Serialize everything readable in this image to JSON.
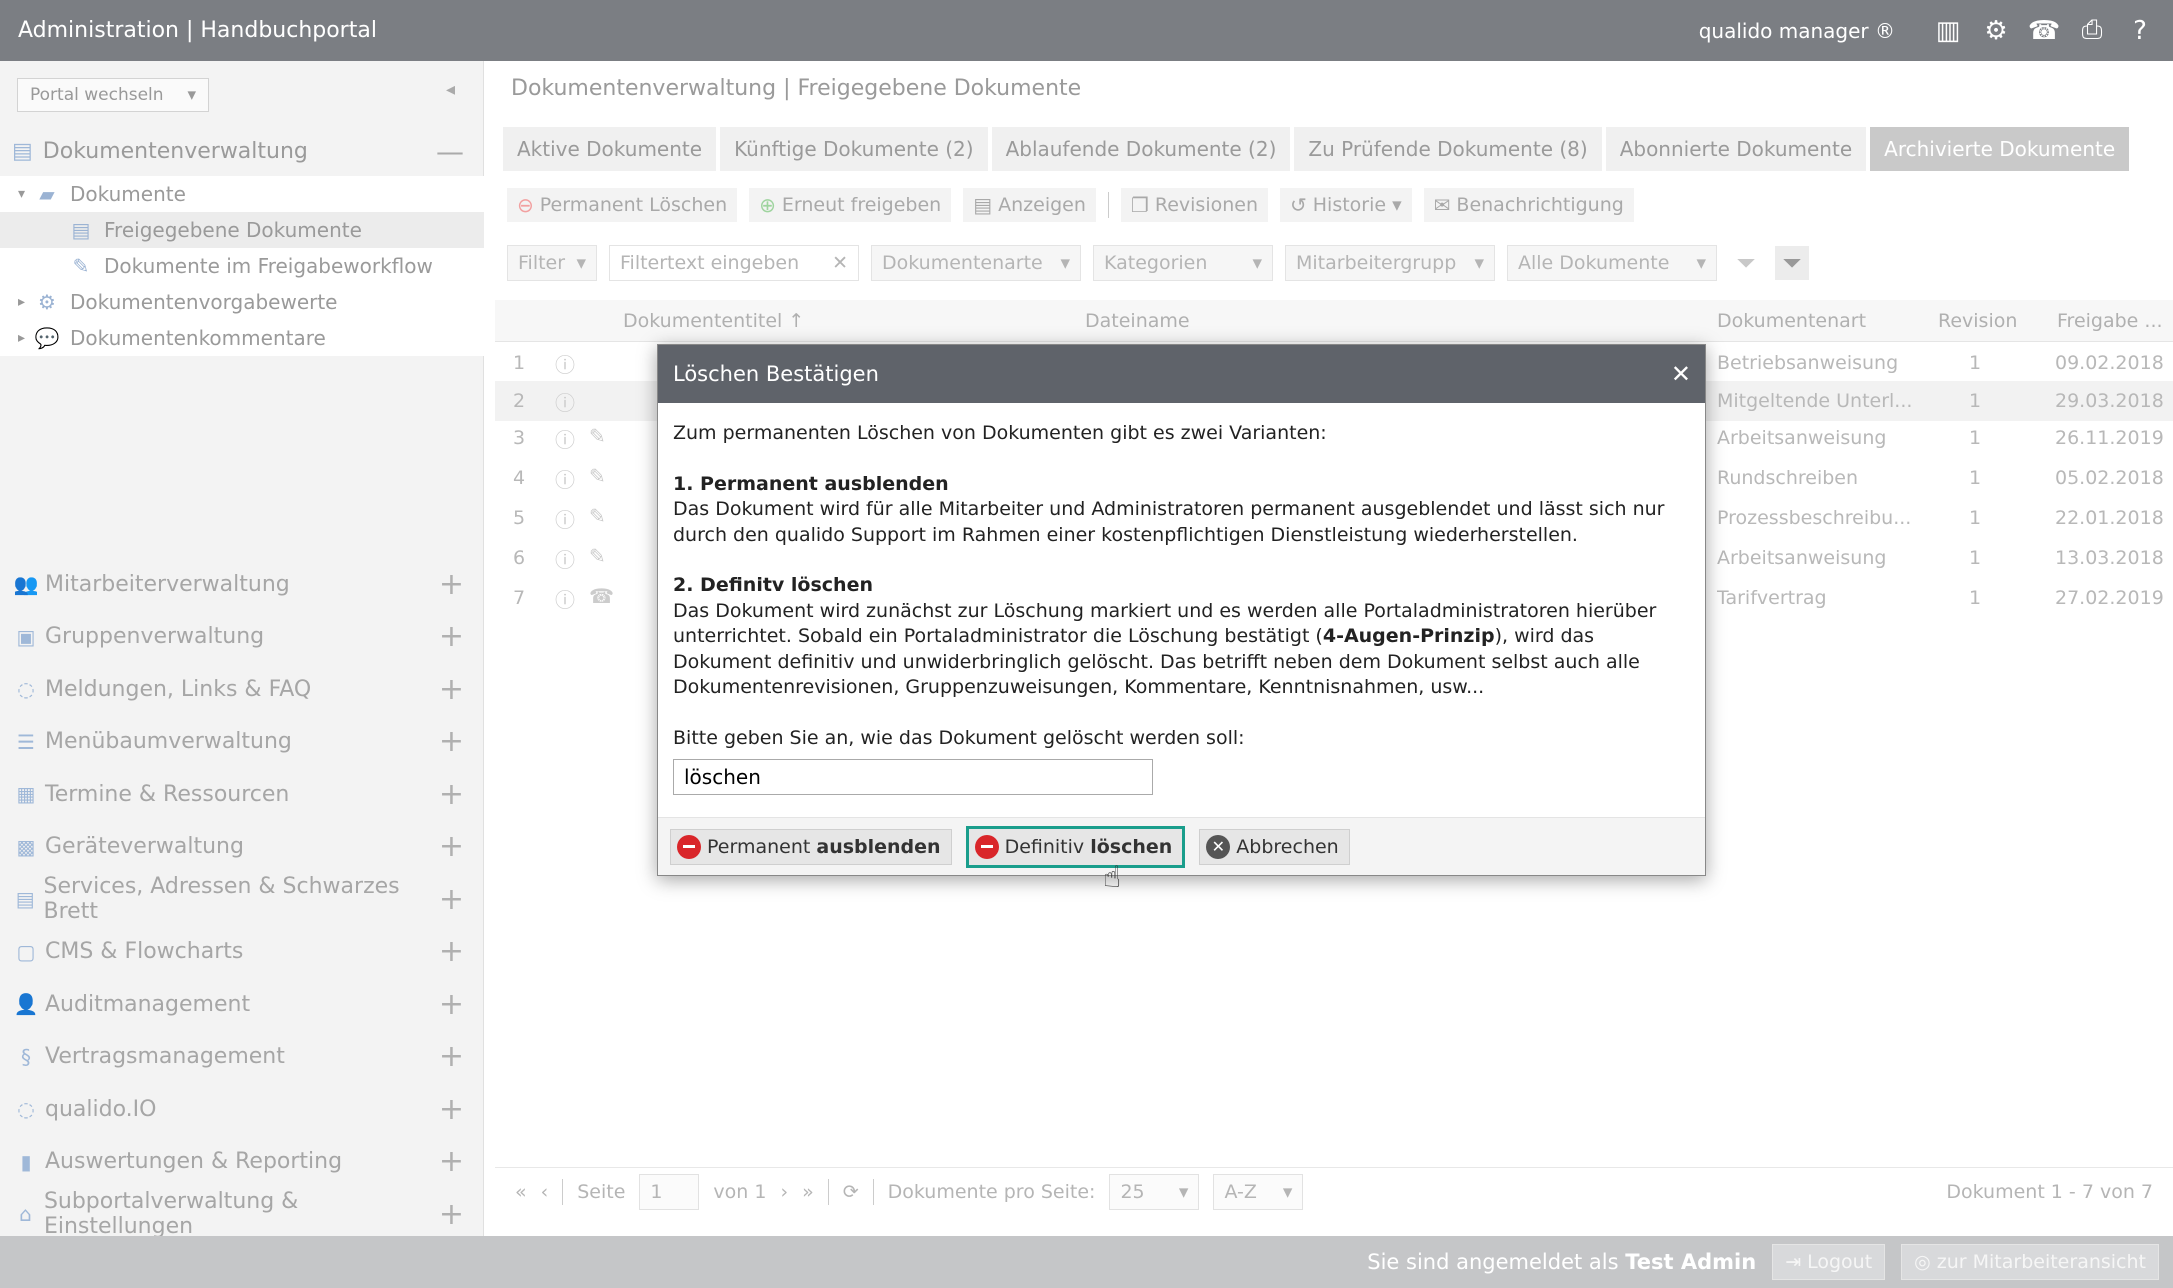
{
  "topbar": {
    "title": "Administration | Handbuchportal",
    "brand": "qualido manager ®"
  },
  "sidebar": {
    "portal_select": "Portal wechseln",
    "open_section": "Dokumentenverwaltung",
    "tree": [
      {
        "label": "Dokumente",
        "level": 1
      },
      {
        "label": "Freigegebene Dokumente",
        "level": 2,
        "selected": true
      },
      {
        "label": "Dokumente im Freigabeworkflow",
        "level": 2
      },
      {
        "label": "Dokumentenvorgabewerte",
        "level": 1
      },
      {
        "label": "Dokumentenkommentare",
        "level": 1
      }
    ],
    "items": [
      {
        "label": "Mitarbeiterverwaltung",
        "icon": "users-icon"
      },
      {
        "label": "Gruppenverwaltung",
        "icon": "group-icon"
      },
      {
        "label": "Meldungen, Links & FAQ",
        "icon": "chat-icon"
      },
      {
        "label": "Menübaumverwaltung",
        "icon": "list-icon"
      },
      {
        "label": "Termine & Ressourcen",
        "icon": "calendar-icon"
      },
      {
        "label": "Geräteverwaltung",
        "icon": "device-icon"
      },
      {
        "label": "Services, Adressen & Schwarzes Brett",
        "icon": "board-icon"
      },
      {
        "label": "CMS & Flowcharts",
        "icon": "cms-icon"
      },
      {
        "label": "Auditmanagement",
        "icon": "user-icon"
      },
      {
        "label": "Vertragsmanagement",
        "icon": "paragraph-icon"
      },
      {
        "label": "qualido.IO",
        "icon": "circle-icon"
      },
      {
        "label": "Auswertungen & Reporting",
        "icon": "bar-chart-icon"
      },
      {
        "label": "Subportalverwaltung & Einstellungen",
        "icon": "home-icon"
      }
    ]
  },
  "main": {
    "page_title": "Dokumentenverwaltung | Freigegebene Dokumente",
    "tabs": [
      "Aktive Dokumente",
      "Künftige Dokumente (2)",
      "Ablaufende Dokumente (2)",
      "Zu Prüfende Dokumente (8)",
      "Abonnierte Dokumente",
      "Archivierte Dokumente"
    ],
    "toolbar": {
      "permanent_delete": "Permanent Löschen",
      "republish": "Erneut freigeben",
      "show": "Anzeigen",
      "revisions": "Revisionen",
      "history": "Historie",
      "notification": "Benachrichtigung"
    },
    "filter": {
      "filter": "Filter",
      "filtertext_placeholder": "Filtertext eingeben",
      "doctype": "Dokumentenarte",
      "categories": "Kategorien",
      "groups": "Mitarbeitergrupp",
      "all_docs": "Alle Dokumente"
    },
    "columns": {
      "title": "Dokumententitel",
      "filename": "Dateiname",
      "doctype": "Dokumentenart",
      "revision": "Revision",
      "release": "Freigabe ..."
    },
    "rows": [
      {
        "n": "1",
        "doctype": "Betriebsanweisung",
        "rev": "1",
        "date": "09.02.2018"
      },
      {
        "n": "2",
        "doctype": "Mitgeltende Unterl...",
        "rev": "1",
        "date": "29.03.2018"
      },
      {
        "n": "3",
        "doctype": "Arbeitsanweisung",
        "rev": "1",
        "date": "26.11.2019"
      },
      {
        "n": "4",
        "doctype": "Rundschreiben",
        "rev": "1",
        "date": "05.02.2018"
      },
      {
        "n": "5",
        "doctype": "Prozessbeschreibu...",
        "rev": "1",
        "date": "22.01.2018"
      },
      {
        "n": "6",
        "doctype": "Arbeitsanweisung",
        "rev": "1",
        "date": "13.03.2018"
      },
      {
        "n": "7",
        "doctype": "Tarifvertrag",
        "rev": "1",
        "date": "27.02.2019"
      }
    ],
    "pager": {
      "page_label": "Seite",
      "page": "1",
      "of": "von 1",
      "per_page_label": "Dokumente pro Seite:",
      "per_page": "25",
      "sort": "A-Z",
      "count": "Dokument 1 - 7 von 7"
    }
  },
  "bottombar": {
    "logged_in_prefix": "Sie sind angemeldet als",
    "user": "Test Admin",
    "logout": "Logout",
    "employee_view": "zur Mitarbeiteransicht"
  },
  "dialog": {
    "title": "Löschen Bestätigen",
    "intro": "Zum permanenten Löschen von Dokumenten gibt es zwei Varianten:",
    "opt1_title": "1. Permanent ausblenden",
    "opt1_text": "Das Dokument wird für alle Mitarbeiter und Administratoren permanent ausgeblendet und lässt sich nur durch den qualido Support im Rahmen einer kostenpflichtigen Dienstleistung wiederherstellen.",
    "opt2_title": "2. Definitv löschen",
    "opt2_text_a": "Das Dokument wird zunächst zur Löschung markiert und es werden alle Portaladministratoren hierüber unterrichtet. Sobald ein Portaladministrator die Löschung bestätigt (",
    "opt2_bold": "4-Augen-Prinzip",
    "opt2_text_b": "), wird das Dokument definitiv und unwiderbringlich gelöscht. Das betrifft neben dem Dokument selbst auch alle Dokumentenrevisionen, Gruppenzuweisungen, Kommentare, Kenntnisnahmen, usw...",
    "prompt": "Bitte geben Sie an, wie das Dokument gelöscht werden soll:",
    "input_value": "löschen",
    "btn_hide_a": "Permanent",
    "btn_hide_b": "ausblenden",
    "btn_delete_a": "Definitiv",
    "btn_delete_b": "löschen",
    "btn_cancel": "Abbrechen"
  }
}
